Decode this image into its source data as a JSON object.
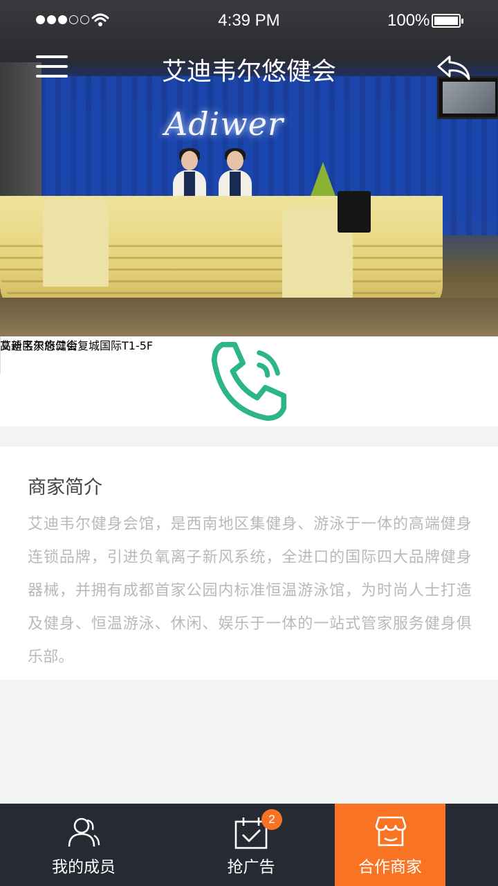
{
  "status_bar": {
    "time": "4:39 PM",
    "battery_percent": "100%",
    "signal_bars_filled": 3,
    "signal_bars_total": 5
  },
  "nav": {
    "title": "艾迪韦尔悠健会",
    "menu_icon": "hamburger-menu-icon",
    "back_icon": "back-arrow-icon"
  },
  "hero": {
    "sign_text": "Adiwer"
  },
  "merchant": {
    "name": "艾迪韦尔悠健会",
    "address": "高新区天府二街复城国际T1-5F",
    "phone_icon": "phone-icon",
    "accent_color": "#2db58a"
  },
  "intro": {
    "title": "商家简介",
    "text": "艾迪韦尔健身会馆，是西南地区集健身、游泳于一体的高端健身连锁品牌，引进负氧离子新风系统，全进口的国际四大品牌健身器械，并拥有成都首家公园内标准恒温游泳馆，为时尚人士打造及健身、恒温游泳、休闲、娱乐于一体的一站式管家服务健身俱乐部。"
  },
  "tabs": [
    {
      "label": "我的成员",
      "icon": "members-icon",
      "active": false
    },
    {
      "label": "抢广告",
      "icon": "calendar-icon",
      "active": false,
      "badge": "2"
    },
    {
      "label": "合作商家",
      "icon": "store-icon",
      "active": true
    }
  ],
  "colors": {
    "tabbar_bg": "#252a33",
    "active_tab_bg": "#f87424",
    "badge_bg": "#f87424"
  }
}
